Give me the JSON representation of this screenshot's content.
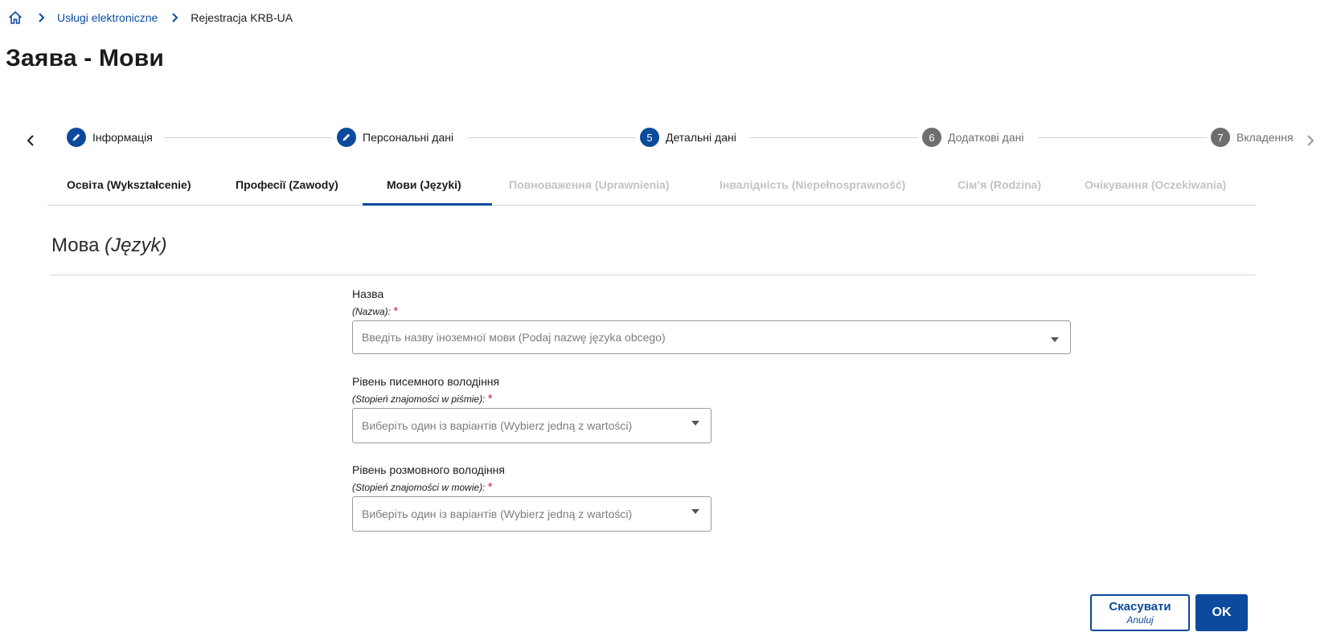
{
  "breadcrumb": {
    "home_icon": "home-icon",
    "items": [
      {
        "label": "Usługi elektroniczne"
      },
      {
        "label": "Rejestracja KRB-UA"
      }
    ]
  },
  "page_title": "Заява - Мови",
  "stepper": {
    "steps": [
      {
        "badge": "",
        "icon": "pencil-icon",
        "label": "Інформація",
        "state": "completed"
      },
      {
        "badge": "",
        "icon": "pencil-icon",
        "label": "Персональні дані",
        "state": "completed"
      },
      {
        "badge": "5",
        "label": "Детальні дані",
        "state": "current"
      },
      {
        "badge": "6",
        "label": "Додаткові дані",
        "state": "upcoming"
      },
      {
        "badge": "7",
        "label": "Вкладення",
        "state": "upcoming"
      }
    ]
  },
  "tabs": [
    {
      "label": "Освіта (Wykształcenie)",
      "state": "enabled"
    },
    {
      "label": "Професії (Zawody)",
      "state": "enabled"
    },
    {
      "label": "Мови (Języki)",
      "state": "active"
    },
    {
      "label": "Повноваження (Uprawnienia)",
      "state": "disabled"
    },
    {
      "label": "Інвалідність (Niepełnosprawność)",
      "state": "disabled"
    },
    {
      "label": "Сім’я (Rodzina)",
      "state": "disabled"
    },
    {
      "label": "Очікування (Oczekiwania)",
      "state": "disabled"
    }
  ],
  "section": {
    "title": "Мова",
    "subtitle": "(Język)"
  },
  "form": {
    "name": {
      "label": "Назва",
      "sublabel": "(Nazwa):",
      "required_mark": "*",
      "placeholder": "Введіть назву іноземної мови (Podaj nazwę języka obcego)"
    },
    "written_level": {
      "label": "Рівень писемного володіння",
      "sublabel": "(Stopień znajomości w piśmie):",
      "required_mark": "*",
      "placeholder": "Виберіть один із варіантів (Wybierz jedną z wartości)"
    },
    "spoken_level": {
      "label": "Рівень розмовного володіння",
      "sublabel": "(Stopień znajomości w mowie):",
      "required_mark": "*",
      "placeholder": "Виберіть один із варіантів (Wybierz jedną z wartości)"
    }
  },
  "buttons": {
    "cancel": {
      "label": "Скасувати",
      "sublabel": "Anuluj"
    },
    "ok": {
      "label": "OK"
    }
  },
  "colors": {
    "accent": "#0b4a9c",
    "required": "#d4203a",
    "disabled_text": "#c3c3c3"
  }
}
